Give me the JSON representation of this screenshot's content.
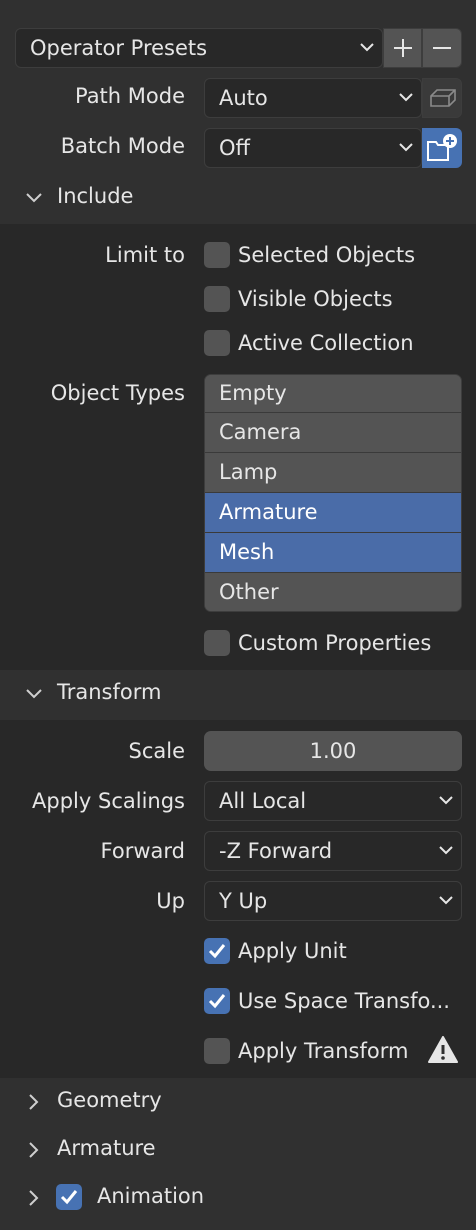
{
  "presets": {
    "label": "Operator Presets",
    "add": "+",
    "remove": "−"
  },
  "path_mode": {
    "label": "Path Mode",
    "value": "Auto"
  },
  "batch_mode": {
    "label": "Batch Mode",
    "value": "Off"
  },
  "include": {
    "title": "Include",
    "limit_to_label": "Limit to",
    "selected_objects": "Selected Objects",
    "visible_objects": "Visible Objects",
    "active_collection": "Active Collection",
    "object_types_label": "Object Types",
    "object_types": [
      "Empty",
      "Camera",
      "Lamp",
      "Armature",
      "Mesh",
      "Other"
    ],
    "custom_properties": "Custom Properties"
  },
  "transform": {
    "title": "Transform",
    "scale_label": "Scale",
    "scale_value": "1.00",
    "apply_scalings_label": "Apply Scalings",
    "apply_scalings_value": "All Local",
    "forward_label": "Forward",
    "forward_value": "-Z Forward",
    "up_label": "Up",
    "up_value": "Y Up",
    "apply_unit": "Apply Unit",
    "use_space_transform": "Use Space Transfo...",
    "apply_transform": "Apply Transform"
  },
  "geometry": {
    "title": "Geometry"
  },
  "armature": {
    "title": "Armature"
  },
  "animation": {
    "title": "Animation"
  },
  "colors": {
    "accent": "#4772b3",
    "selected": "#4a6ca8",
    "panel": "#303030",
    "field": "#282828"
  }
}
